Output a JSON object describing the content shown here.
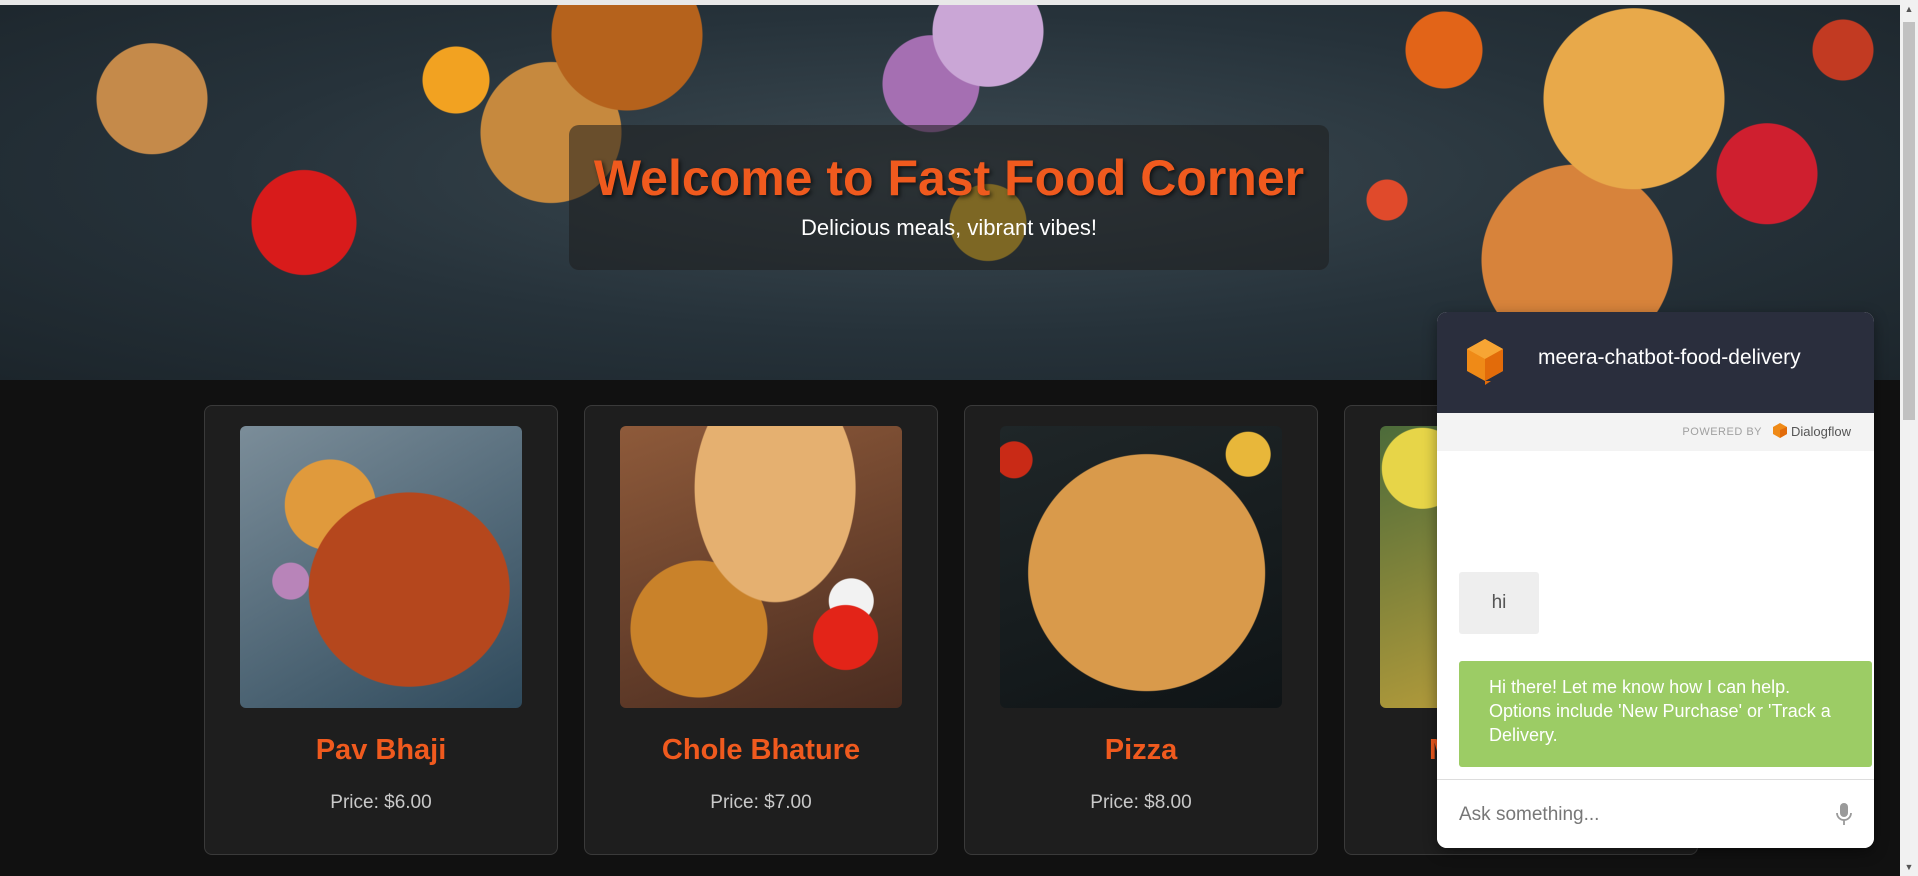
{
  "hero": {
    "title": "Welcome to Fast Food Corner",
    "subtitle": "Delicious meals, vibrant vibes!"
  },
  "menu": [
    {
      "name": "Pav Bhaji",
      "price": "Price: $6.00"
    },
    {
      "name": "Chole Bhature",
      "price": "Price: $7.00"
    },
    {
      "name": "Pizza",
      "price": "Price: $8.00"
    },
    {
      "name": "M",
      "price": ""
    }
  ],
  "chatbot": {
    "title": "meera-chatbot-food-delivery",
    "powered_label": "POWERED BY",
    "powered_brand": "Dialogflow",
    "messages": {
      "user": "hi",
      "bot": "Hi there! Let me know how I can help. Options include 'New Purchase' or 'Track a Delivery."
    },
    "input_placeholder": "Ask something..."
  },
  "colors": {
    "accent": "#f05a1e",
    "chat_header": "#2a2e3d",
    "bot_bubble": "#9ccc65",
    "dialogflow_orange": "#ef6c00"
  },
  "icons": {
    "chat_logo": "dialogflow-cube-icon",
    "mic": "microphone-icon"
  }
}
